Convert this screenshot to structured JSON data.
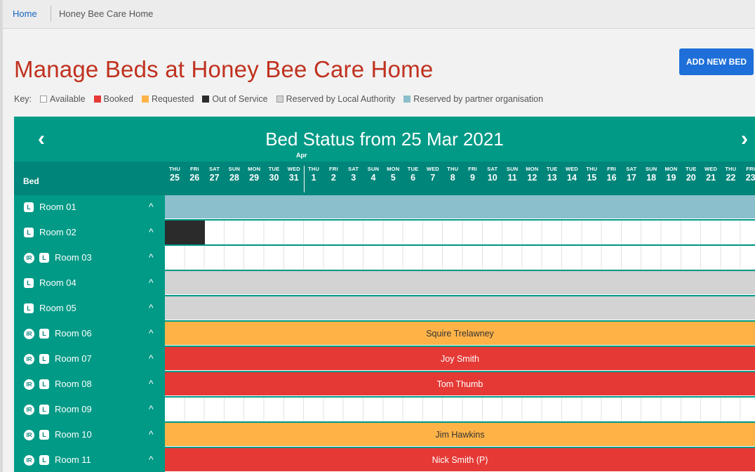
{
  "breadcrumb": {
    "home": "Home",
    "current": "Honey Bee Care Home"
  },
  "page": {
    "title": "Manage Beds at Honey Bee Care Home",
    "add_button": "ADD NEW BED"
  },
  "key": {
    "label": "Key:",
    "items": [
      {
        "label": "Available",
        "color": "#ffffff",
        "border": "#999999"
      },
      {
        "label": "Booked",
        "color": "#e53935"
      },
      {
        "label": "Requested",
        "color": "#ffb347"
      },
      {
        "label": "Out of Service",
        "color": "#2b2b2b"
      },
      {
        "label": "Reserved by Local Authority",
        "color": "#d3d3d3",
        "border": "#999999"
      },
      {
        "label": "Reserved by partner organisation",
        "color": "#8bbfcc"
      }
    ]
  },
  "calendar": {
    "title": "Bed Status from 25 Mar 2021",
    "month_label": "Apr",
    "bed_header": "Bed",
    "nav_prev_icon": "chevron-left-icon",
    "nav_next_icon": "chevron-right-icon",
    "days": [
      {
        "dow": "THU",
        "day": "25"
      },
      {
        "dow": "FRI",
        "day": "26"
      },
      {
        "dow": "SAT",
        "day": "27"
      },
      {
        "dow": "SUN",
        "day": "28"
      },
      {
        "dow": "MON",
        "day": "29"
      },
      {
        "dow": "TUE",
        "day": "30"
      },
      {
        "dow": "WED",
        "day": "31"
      },
      {
        "dow": "THU",
        "day": "1"
      },
      {
        "dow": "FRI",
        "day": "2"
      },
      {
        "dow": "SAT",
        "day": "3"
      },
      {
        "dow": "SUN",
        "day": "4"
      },
      {
        "dow": "MON",
        "day": "5"
      },
      {
        "dow": "TUE",
        "day": "6"
      },
      {
        "dow": "WED",
        "day": "7"
      },
      {
        "dow": "THU",
        "day": "8"
      },
      {
        "dow": "FRI",
        "day": "9"
      },
      {
        "dow": "SAT",
        "day": "10"
      },
      {
        "dow": "SUN",
        "day": "11"
      },
      {
        "dow": "MON",
        "day": "12"
      },
      {
        "dow": "TUE",
        "day": "13"
      },
      {
        "dow": "WED",
        "day": "14"
      },
      {
        "dow": "THU",
        "day": "15"
      },
      {
        "dow": "FRI",
        "day": "16"
      },
      {
        "dow": "SAT",
        "day": "17"
      },
      {
        "dow": "SUN",
        "day": "18"
      },
      {
        "dow": "MON",
        "day": "19"
      },
      {
        "dow": "TUE",
        "day": "20"
      },
      {
        "dow": "WED",
        "day": "21"
      },
      {
        "dow": "THU",
        "day": "22"
      },
      {
        "dow": "FRI",
        "day": "23"
      }
    ],
    "rows": [
      {
        "room": "Room 01",
        "ir": false,
        "status": "reserved-partner",
        "text": ""
      },
      {
        "room": "Room 02",
        "ir": false,
        "status": "available",
        "text": "",
        "oos_days": 2
      },
      {
        "room": "Room 03",
        "ir": true,
        "status": "available",
        "text": ""
      },
      {
        "room": "Room 04",
        "ir": false,
        "status": "reserved-la",
        "text": ""
      },
      {
        "room": "Room 05",
        "ir": false,
        "status": "reserved-la",
        "text": ""
      },
      {
        "room": "Room 06",
        "ir": true,
        "status": "requested",
        "text": "Squire Trelawney"
      },
      {
        "room": "Room 07",
        "ir": true,
        "status": "booked",
        "text": "Joy Smith"
      },
      {
        "room": "Room 08",
        "ir": true,
        "status": "booked",
        "text": "Tom Thumb"
      },
      {
        "room": "Room 09",
        "ir": true,
        "status": "available",
        "text": ""
      },
      {
        "room": "Room 10",
        "ir": true,
        "status": "requested",
        "text": "Jim Hawkins"
      },
      {
        "room": "Room 11",
        "ir": true,
        "status": "booked",
        "text": "Nick Smith (P)"
      }
    ],
    "badges": {
      "ir": "IR",
      "l": "L"
    },
    "chevron": "^"
  }
}
